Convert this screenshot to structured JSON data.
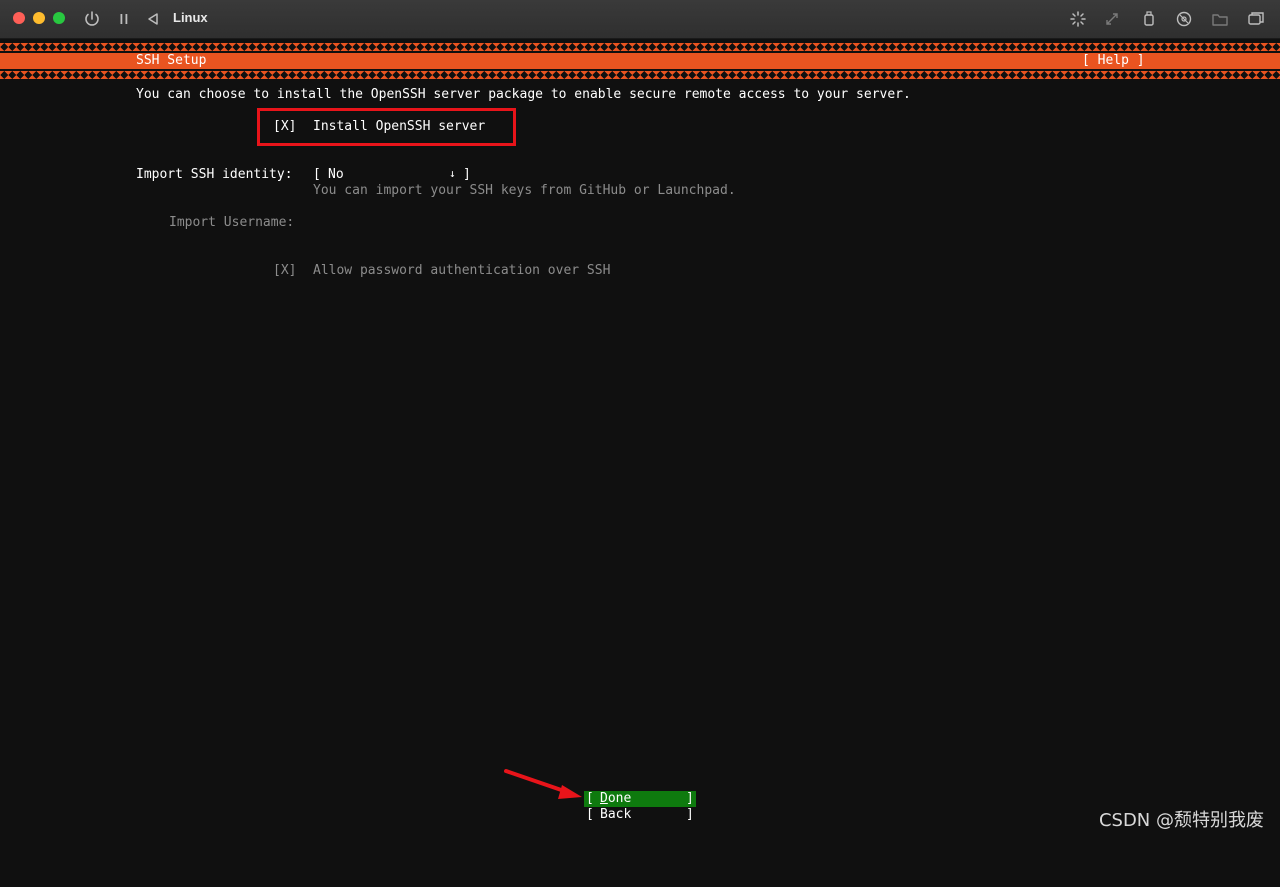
{
  "window": {
    "title": "Linux",
    "icons": [
      "power-icon",
      "pause-icon",
      "back-icon",
      "brightness-icon",
      "resize-icon",
      "usb-icon",
      "cd-icon",
      "folder-icon",
      "windows-icon"
    ]
  },
  "header": {
    "title": "SSH Setup",
    "help": "[ Help ]",
    "accent_color": "#e95420"
  },
  "content": {
    "intro": "You can choose to install the OpenSSH server package to enable secure remote access to your server.",
    "install_checkbox": {
      "mark": "[X]",
      "label": "Install OpenSSH server"
    },
    "import_identity": {
      "label": "Import SSH identity:",
      "select_open": "[ ",
      "value": "No",
      "arrow": "↓",
      "select_close": "]",
      "help": "You can import your SSH keys from GitHub or Launchpad."
    },
    "import_username": {
      "label": "Import Username:"
    },
    "password_checkbox": {
      "mark": "[X]",
      "label": "Allow password authentication over SSH"
    }
  },
  "buttons": {
    "done": {
      "open": "[",
      "label_first": "D",
      "label_rest": "one",
      "close": "]",
      "color": "#0e7a0e"
    },
    "back": {
      "open": "[",
      "label": "Back",
      "close": "]"
    }
  },
  "annotation": {
    "box_color": "#e8141a",
    "arrow_color": "#e8141a"
  },
  "watermark": "CSDN @颓特别我废"
}
